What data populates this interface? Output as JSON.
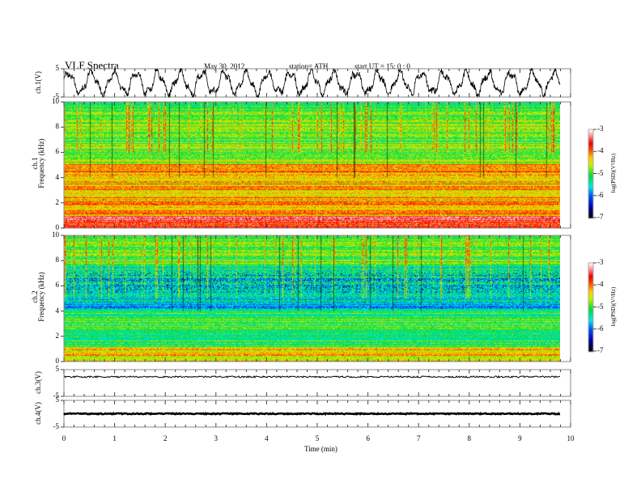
{
  "header": {
    "title": "VLF  Spectra",
    "date": "May 30, 2012",
    "station": "station= ATH",
    "start": "start  UT  =    15: 0   : 0"
  },
  "chart_data": [
    {
      "type": "line",
      "name_label": "ch.1(V)",
      "ylim": [
        -5,
        5
      ],
      "yticks": [
        "5",
        "-5"
      ],
      "xlim": [
        0,
        10
      ]
    },
    {
      "type": "heatmap",
      "ylabel_top": "ch.1",
      "ylabel": "Frequency  (kHz)",
      "ylim": [
        0,
        10
      ],
      "yticks": [
        "0",
        "2",
        "4",
        "6",
        "8",
        "10"
      ],
      "colorbar": {
        "label": "log(PSD)(V²/Hz)",
        "range": [
          -7,
          -3
        ],
        "ticks": [
          "-3",
          "-4",
          "-5",
          "-6",
          "-7"
        ]
      }
    },
    {
      "type": "heatmap",
      "ylabel_top": "ch.2",
      "ylabel": "Frequency  (kHz)",
      "ylim": [
        0,
        10
      ],
      "yticks": [
        "0",
        "2",
        "4",
        "6",
        "8",
        "10"
      ],
      "colorbar": {
        "label": "log(PSD)(V²/Hz)",
        "range": [
          -7,
          -3
        ],
        "ticks": [
          "-3",
          "-4",
          "-5",
          "-6",
          "-7"
        ]
      }
    },
    {
      "type": "line",
      "name_label": "ch.3(V)",
      "ylim": [
        -5,
        5
      ],
      "yticks": [
        "5",
        "-5"
      ],
      "level": 2.3
    },
    {
      "type": "line",
      "name_label": "ch.4(V)",
      "ylim": [
        -5,
        5
      ],
      "yticks": [
        "5",
        "-5"
      ],
      "level": 0
    }
  ],
  "xaxis": {
    "label": "Time  (min)",
    "range": [
      0,
      10
    ],
    "data_end": 9.8,
    "ticks": [
      "0",
      "1",
      "2",
      "3",
      "4",
      "5",
      "6",
      "7",
      "8",
      "9",
      "10"
    ]
  }
}
